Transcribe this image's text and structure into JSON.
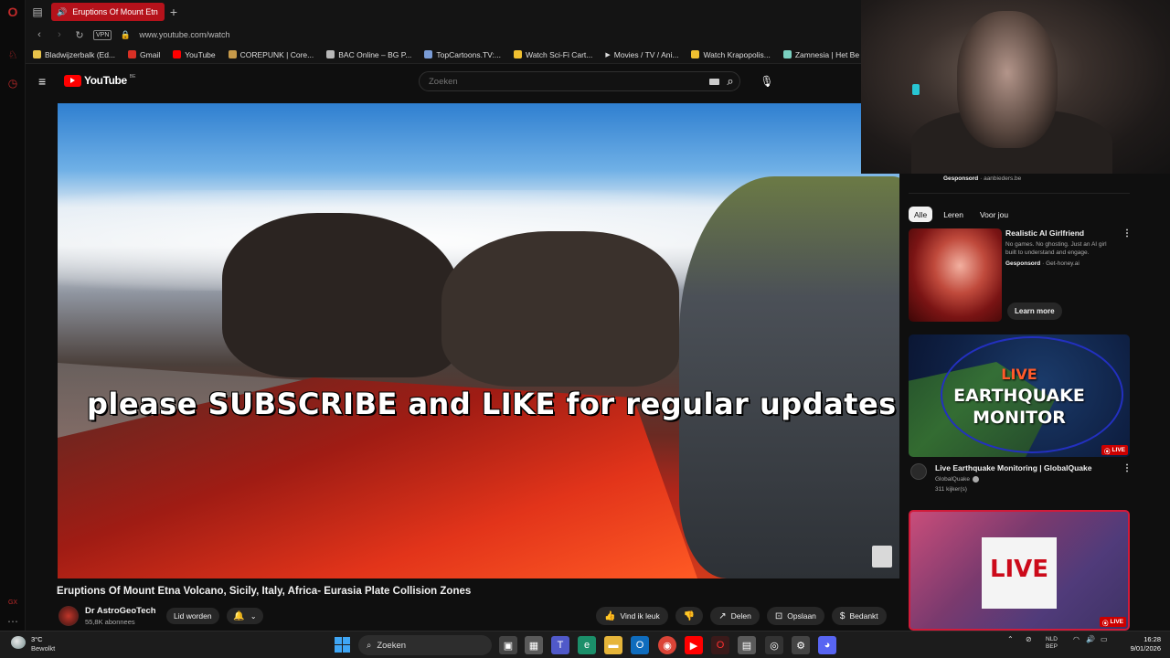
{
  "browser": {
    "tab": {
      "title": "Eruptions Of Mount Etn"
    },
    "url": "www.youtube.com/watch",
    "vpn_label": "VPN",
    "bookmarks": [
      {
        "label": "Bladwijzerbalk (Ed...",
        "icon": "folder-icon",
        "color": "#e8c34a"
      },
      {
        "label": "Gmail",
        "icon": "gmail-icon",
        "color": "#d93025"
      },
      {
        "label": "YouTube",
        "icon": "youtube-icon",
        "color": "#ff0000"
      },
      {
        "label": "COREPUNK | Core...",
        "icon": "corepunk-icon",
        "color": "#c79a4a"
      },
      {
        "label": "BAC Online – BG P...",
        "icon": "bac-icon",
        "color": "#b8b8b8"
      },
      {
        "label": "TopCartoons.TV:...",
        "icon": "topcartoons-icon",
        "color": "#7a9cd6"
      },
      {
        "label": "Watch Sci-Fi Cart...",
        "icon": "scifi-icon",
        "color": "#f0c030"
      },
      {
        "label": "Movies / TV / Ani...",
        "icon": "play-icon",
        "color": "#ffffff"
      },
      {
        "label": "Watch Krapopolis...",
        "icon": "krapopolis-icon",
        "color": "#f0c030"
      },
      {
        "label": "Zamnesia | Het Be",
        "icon": "zamnesia-icon",
        "color": "#7ad0c0"
      }
    ]
  },
  "youtube": {
    "logo_text": "YouTube",
    "country_code": "BE",
    "search_placeholder": "Zoeken",
    "video": {
      "caption": "please SUBSCRIBE and LIKE for regular updates",
      "title": "Eruptions Of Mount Etna Volcano, Sicily, Italy, Africa- Eurasia Plate Collision Zones"
    },
    "channel": {
      "name": "Dr AstroGeoTech",
      "subscribers": "55,8K abonnees"
    },
    "join_label": "Lid worden",
    "actions": [
      {
        "label": "Vind ik leuk",
        "icon": "thumbs-up-icon",
        "glyph": "👍"
      },
      {
        "label": "",
        "icon": "thumbs-down-icon",
        "glyph": "👎"
      },
      {
        "label": "Delen",
        "icon": "share-icon",
        "glyph": "↗"
      },
      {
        "label": "Opslaan",
        "icon": "bookmark-icon",
        "glyph": "⊡"
      },
      {
        "label": "Bedankt",
        "icon": "thanks-icon",
        "glyph": "$"
      },
      {
        "label": "",
        "icon": "more-icon",
        "glyph": "⋯"
      }
    ]
  },
  "sidebar": {
    "top_sponsored": {
      "label": "Gesponsord",
      "source": "aanbieders.be"
    },
    "chips": [
      "Alle",
      "Leren",
      "Voor jou"
    ],
    "ad": {
      "title": "Realistic AI Girlfriend",
      "description": "No games. No ghosting. Just an AI girl built to understand and engage.",
      "sponsored_label": "Gesponsord",
      "sponsor_source": "Get-honey.ai",
      "cta": "Learn more"
    },
    "rec1": {
      "thumb_line1": "LIVE",
      "thumb_line2": "EARTHQUAKE",
      "thumb_line3": "MONITOR",
      "badge": "LIVE",
      "title": "Live Earthquake Monitoring | GlobalQuake",
      "channel": "GlobalQuake",
      "viewers": "311 kijker(s)"
    },
    "rec2": {
      "thumb_text": "LIVE",
      "badge": "LIVE"
    }
  },
  "taskbar": {
    "weather_temp": "3°C",
    "weather_desc": "Bewolkt",
    "search_label": "Zoeken",
    "lang_line1": "NLD",
    "lang_line2": "BEP",
    "time": "16:28",
    "date": "9/01/2026"
  }
}
